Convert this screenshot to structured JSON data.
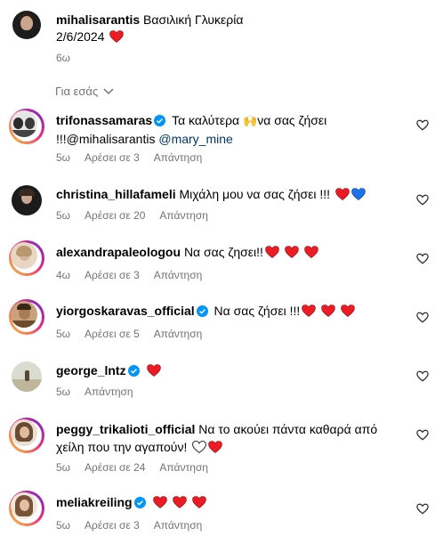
{
  "caption": {
    "username": "mihalisarantis",
    "text": "Βασιλική Γλυκερία",
    "date": "2/6/2024",
    "time": "6ω"
  },
  "section_label": "Για εσάς",
  "comments": [
    {
      "username": "trifonassamaras",
      "verified": true,
      "text_a": "Τα καλύτερα",
      "emoji": "🙌",
      "text_b": "να σας ζήσει",
      "line2": "!!!@mihalisarantis",
      "mention": "@mary_mine",
      "time": "5ω",
      "likes": "Αρέσει σε 3",
      "reply": "Απάντηση"
    },
    {
      "username": "christina_hillafameli",
      "verified": false,
      "text": "Μιχάλη μου να σας ζήσει !!!",
      "time": "5ω",
      "likes": "Αρέσει σε 20",
      "reply": "Απάντηση"
    },
    {
      "username": "alexandrapaleologou",
      "verified": false,
      "text": "Να σας ζησει!!",
      "time": "4ω",
      "likes": "Αρέσει σε 3",
      "reply": "Απάντηση"
    },
    {
      "username": "yiorgoskaravas_official",
      "verified": true,
      "text": "Να σας ζήσει !!!",
      "time": "5ω",
      "likes": "Αρέσει σε 5",
      "reply": "Απάντηση"
    },
    {
      "username": "george_lntz",
      "verified": true,
      "text": "",
      "time": "5ω",
      "reply": "Απάντηση"
    },
    {
      "username": "peggy_trikalioti_official",
      "verified": false,
      "text": "Να το ακούει πάντα καθαρά από",
      "line2": "χείλη που την αγαπούν!",
      "time": "5ω",
      "likes": "Αρέσει σε 24",
      "reply": "Απάντηση"
    },
    {
      "username": "meliakreiling",
      "verified": true,
      "text": "",
      "time": "5ω",
      "likes": "Αρέσει σε 3",
      "reply": "Απάντηση"
    }
  ],
  "colors": {
    "heart_red": "#ed1c24",
    "heart_blue": "#1a73e8",
    "verified": "#0095f6",
    "muted": "#737373"
  }
}
